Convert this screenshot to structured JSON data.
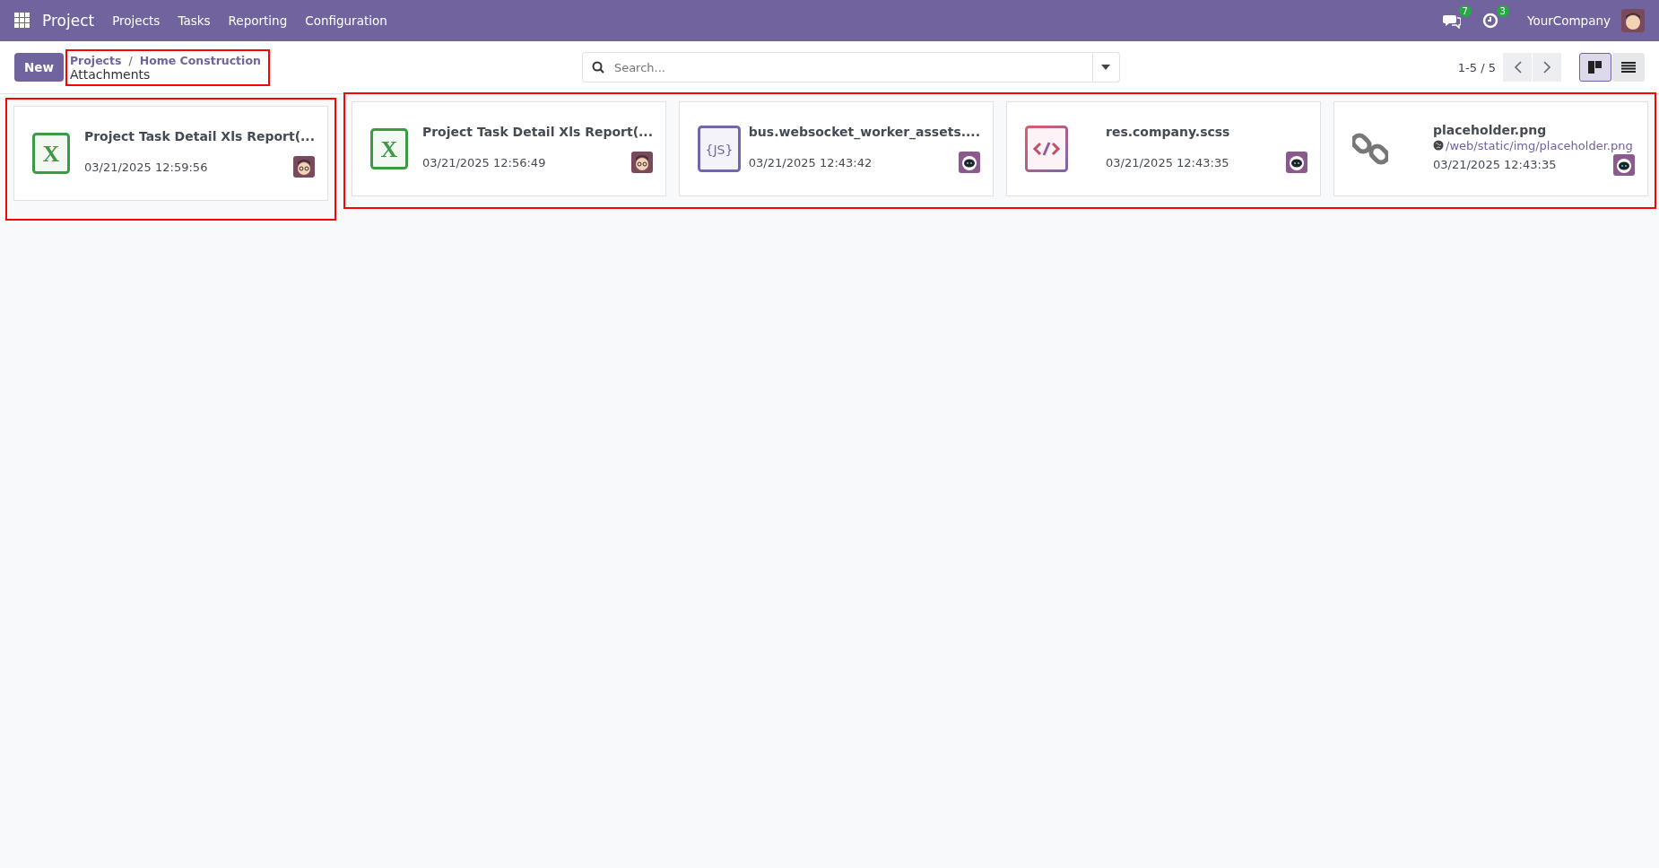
{
  "navbar": {
    "app_name": "Project",
    "menu": [
      "Projects",
      "Tasks",
      "Reporting",
      "Configuration"
    ],
    "messages_count": "7",
    "activities_count": "3",
    "company": "YourCompany"
  },
  "control_panel": {
    "new_button": "New",
    "breadcrumb": {
      "highlighted": true,
      "items": [
        "Projects",
        "Home Construction"
      ],
      "separator": "/",
      "current": "Attachments"
    },
    "search": {
      "placeholder": "Search..."
    },
    "pager": "1-5 / 5",
    "views": [
      {
        "kind": "kanban",
        "selected": true
      },
      {
        "kind": "list",
        "selected": false
      }
    ]
  },
  "card_groups": [
    {
      "highlighted": true,
      "cards": [
        {
          "kind": "xls",
          "icon_label": "X",
          "name": "Project Task Detail Xls Report(...",
          "date": "03/21/2025 12:59:56",
          "owner": {
            "kind": "user"
          }
        }
      ]
    },
    {
      "highlighted": true,
      "cards": [
        {
          "kind": "xls",
          "icon_label": "X",
          "name": "Project Task Detail Xls Report(...",
          "date": "03/21/2025 12:56:49",
          "owner": {
            "kind": "user"
          }
        },
        {
          "kind": "js",
          "icon_label": "{JS}",
          "name": "bus.websocket_worker_assets....",
          "date": "03/21/2025 12:43:42",
          "owner": {
            "kind": "bot"
          }
        },
        {
          "kind": "code",
          "name": "res.company.scss",
          "date": "03/21/2025 12:43:35",
          "owner": {
            "kind": "bot"
          }
        },
        {
          "kind": "url",
          "name": "placeholder.png",
          "url": "/web/static/img/placeholder.png",
          "date": "03/21/2025 12:43:35",
          "owner": {
            "kind": "bot"
          }
        }
      ]
    }
  ]
}
